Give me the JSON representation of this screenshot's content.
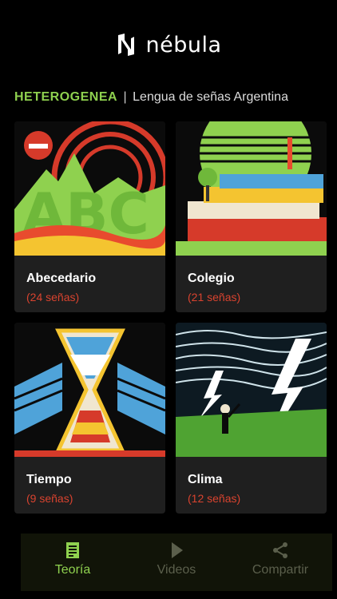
{
  "app": {
    "logo_text": "nébula"
  },
  "section": {
    "brand": "HETEROGENEA",
    "separator": "|",
    "subtitle": "Lengua de señas Argentina"
  },
  "cards": [
    {
      "title": "Abecedario",
      "count": "(24 señas)",
      "icon": "abc-illustration"
    },
    {
      "title": "Colegio",
      "count": "(21 señas)",
      "icon": "school-books-illustration"
    },
    {
      "title": "Tiempo",
      "count": "(9 señas)",
      "icon": "hourglass-illustration"
    },
    {
      "title": "Clima",
      "count": "(12 señas)",
      "icon": "storm-illustration"
    }
  ],
  "nav": [
    {
      "label": "Teoría",
      "icon": "document-icon",
      "active": true
    },
    {
      "label": "Videos",
      "icon": "play-icon",
      "active": false
    },
    {
      "label": "Compartir",
      "icon": "share-icon",
      "active": false
    }
  ],
  "colors": {
    "accent": "#8fd14f",
    "count": "#d9432f",
    "card_bg": "#1f1f1f",
    "nav_bg": "#111408"
  }
}
